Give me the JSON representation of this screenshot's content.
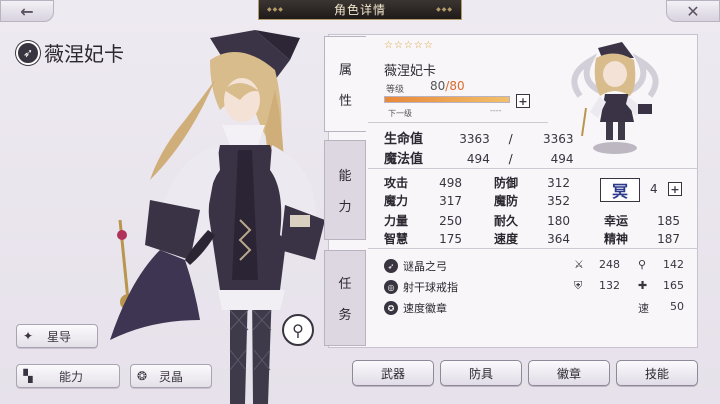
{
  "header": {
    "title": "角色详情",
    "back_icon": "←",
    "close_icon": "✕"
  },
  "character": {
    "name": "薇涅妃卡",
    "stars": "☆☆☆☆☆",
    "level_label": "等级",
    "level": "80",
    "level_max": "80",
    "level_sep": "/",
    "exp_fraction": 1.0,
    "next_label": "下一级",
    "next_value": "----"
  },
  "side_tabs": [
    {
      "c1": "属",
      "c2": "性"
    },
    {
      "c1": "能",
      "c2": "力"
    },
    {
      "c1": "任",
      "c2": "务"
    }
  ],
  "stats": {
    "hp_label": "生命值",
    "hp": "3363",
    "hp_max": "3363",
    "mp_label": "魔法值",
    "mp": "494",
    "mp_max": "494",
    "sep": "/",
    "atk_label": "攻击",
    "atk": "498",
    "def_label": "防御",
    "def": "312",
    "mag_label": "魔力",
    "mag": "317",
    "mdef_label": "魔防",
    "mdef": "352",
    "str_label": "力量",
    "str": "250",
    "end_label": "耐久",
    "end": "180",
    "luck_label": "幸运",
    "luck": "185",
    "int_label": "智慧",
    "int": "175",
    "spd_label": "速度",
    "spd": "364",
    "spi_label": "精神",
    "spi": "187"
  },
  "ring": {
    "badge": "冥",
    "count": "4"
  },
  "equipment": [
    {
      "name": "谜晶之弓",
      "v1": "248",
      "v2": "142"
    },
    {
      "name": "射干球戒指",
      "v1": "132",
      "v2": "165"
    },
    {
      "name": "速度徽章",
      "v2_label": "速",
      "v2": "50"
    }
  ],
  "left_buttons": {
    "guide": "星导",
    "ability": "能力",
    "crystal": "灵晶"
  },
  "bottom_buttons": [
    "武器",
    "防具",
    "徽章",
    "技能"
  ],
  "colors": {
    "accent": "#d86a2c",
    "dark": "#2c2730",
    "gold": "#b49b6a"
  }
}
